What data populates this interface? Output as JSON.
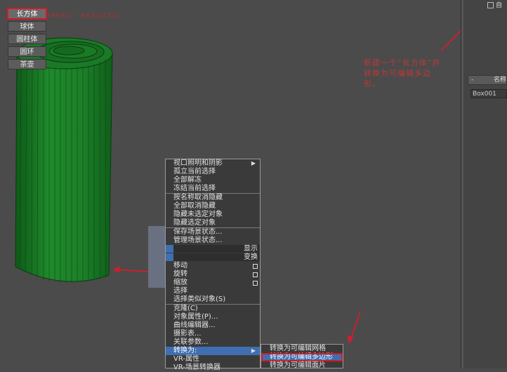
{
  "viewport": {
    "label": "ORTHOGRAPHIC · REALISTIC"
  },
  "command_panel": {
    "autogrid_label": "自",
    "primitives": [
      "长方体",
      "球体",
      "圆柱体",
      "圆环",
      "茶壶"
    ],
    "active_primitive": "长方体",
    "name_rollout": {
      "collapse": "-",
      "title": "名称"
    },
    "name_value": "Box001"
  },
  "annotation": {
    "text": "新建一个“长方体”并转换为可编辑多边形。"
  },
  "quad_menu": {
    "top_left": [
      {
        "label": "视口照明和阴影",
        "submenu": true
      },
      {
        "label": "孤立当前选择"
      },
      {
        "label": "全部解冻"
      },
      {
        "label": "冻结当前选择"
      },
      {
        "label": "按名称取消隐藏"
      },
      {
        "label": "全部取消隐藏"
      },
      {
        "label": "隐藏未选定对象"
      },
      {
        "label": "隐藏选定对象"
      },
      {
        "label": "保存场景状态..."
      },
      {
        "label": "管理场景状态..."
      }
    ],
    "display_header": "显示",
    "transform_header": "变换",
    "bottom_left": [
      {
        "label": "移动",
        "settings": true
      },
      {
        "label": "旋转",
        "settings": true
      },
      {
        "label": "缩放",
        "settings": true
      },
      {
        "label": "选择"
      },
      {
        "label": "选择类似对象(S)"
      },
      {
        "label": "克隆(C)"
      },
      {
        "label": "对象属性(P)..."
      },
      {
        "label": "曲线编辑器..."
      },
      {
        "label": "摄影表..."
      },
      {
        "label": "关联参数..."
      },
      {
        "label": "转换为:",
        "submenu": true,
        "highlighted": true
      },
      {
        "label": "VR-属性"
      },
      {
        "label": "VR-场景转换器"
      }
    ],
    "convert_submenu": [
      {
        "label": "转换为可编辑网格"
      },
      {
        "label": "转换为可编辑多边形",
        "highlighted": true
      },
      {
        "label": "转换为可编辑面片"
      }
    ]
  },
  "colors": {
    "accent_red": "#d11a2a",
    "menu_highlight": "#3f6fb0",
    "object_green": "#1f8a2c"
  }
}
